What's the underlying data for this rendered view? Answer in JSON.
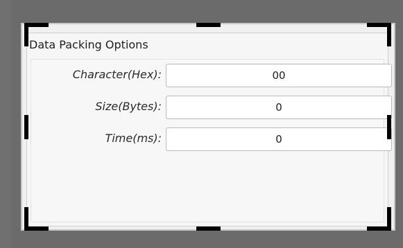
{
  "group": {
    "title": "Data Packing Options"
  },
  "fields": [
    {
      "label": "Character(Hex):",
      "value": "00"
    },
    {
      "label": "Size(Bytes):",
      "value": "0"
    },
    {
      "label": "Time(ms):",
      "value": "0"
    }
  ],
  "colors": {
    "canvas_background": "#6b6b6b",
    "panel_background": "#f0f0f0",
    "handle_color": "#000000"
  },
  "icons": {
    "selection_handles": "resize-handle-icon"
  }
}
